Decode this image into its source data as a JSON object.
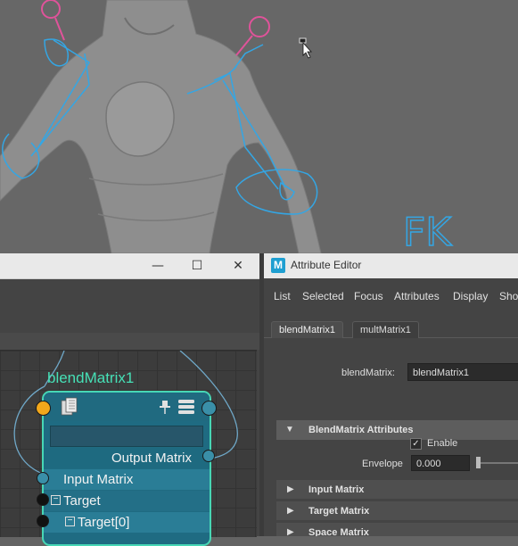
{
  "viewport": {
    "fk_label": "FK"
  },
  "node_editor": {
    "window_controls": {
      "minimize": "—",
      "maximize": "☐",
      "close": "✕"
    },
    "node": {
      "name": "blendMatrix1",
      "rows": {
        "output": "Output Matrix",
        "input": "Input Matrix",
        "target": "Target",
        "target0": "Target[0]"
      },
      "tree_toggle": "−"
    }
  },
  "attribute_editor": {
    "title": "Attribute Editor",
    "logo": "M",
    "menu": [
      "List",
      "Selected",
      "Focus",
      "Attributes",
      "Display",
      "Show"
    ],
    "tabs": [
      "blendMatrix1",
      "multMatrix1"
    ],
    "node_label": "blendMatrix:",
    "node_value": "blendMatrix1",
    "sections": {
      "blend": "BlendMatrix Attributes",
      "input_matrix": "Input Matrix",
      "target_matrix": "Target Matrix",
      "space_matrix": "Space Matrix"
    },
    "enable_label": "Enable",
    "enable_checked": "✓",
    "envelope_label": "Envelope",
    "envelope_value": "0.000",
    "arrow_open": "▼",
    "arrow_closed": "▶"
  },
  "colors": {
    "node_accent": "#47d7b5",
    "rig_blue": "#34a6e4",
    "control_pink": "#e0539a",
    "port_orange": "#f2a71b"
  }
}
